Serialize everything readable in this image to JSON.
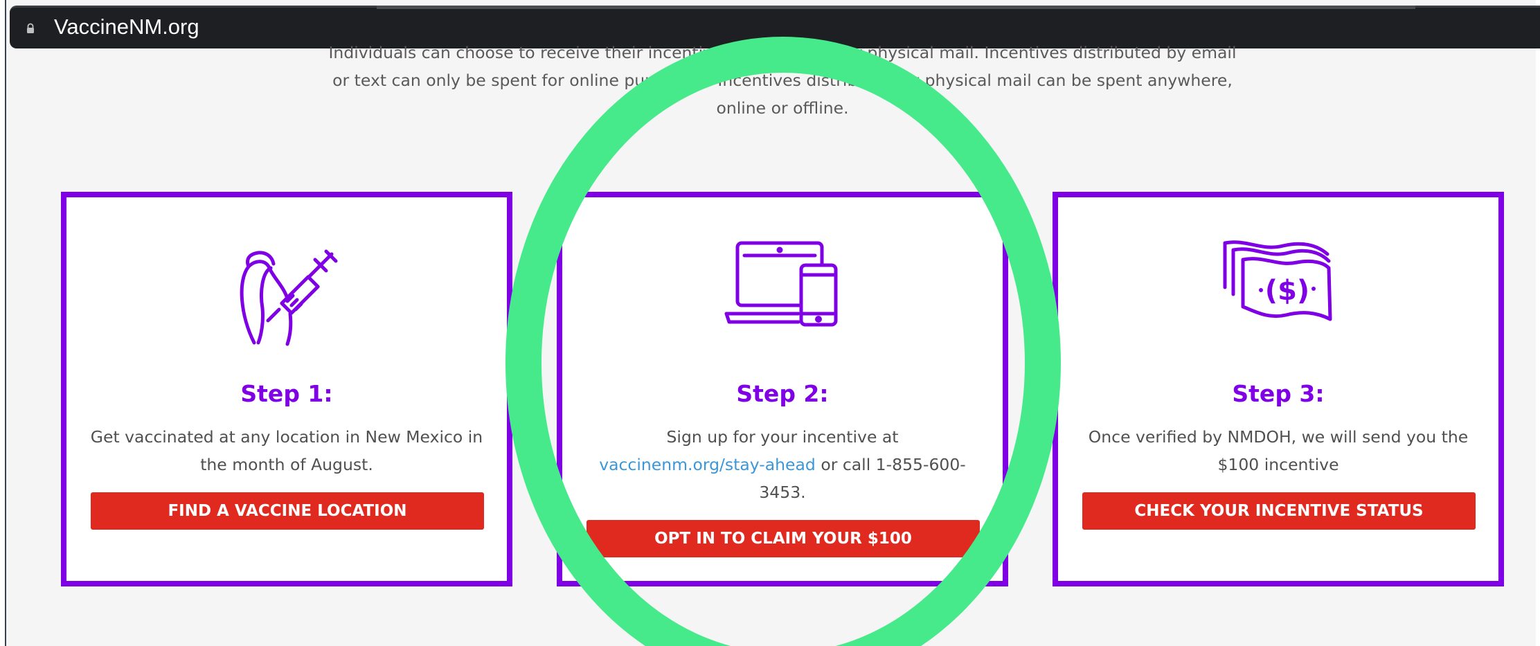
{
  "browser": {
    "url": "VaccineNM.org"
  },
  "intro": {
    "line1": "Individuals can choose to receive their incentive by email, text or physical mail. Incentives distributed by email",
    "line2": "or text can only be spent for online purchases. Incentives distributed by physical mail can be spent anywhere,",
    "line3": "online or offline."
  },
  "steps": [
    {
      "title": "Step 1:",
      "text": "Get vaccinated at any location in New Mexico in the month of August.",
      "button": "FIND A VACCINE LOCATION",
      "icon": "vaccine-arm-icon"
    },
    {
      "title": "Step 2:",
      "text_before": "Sign up for your incentive at",
      "link": "vaccinenm.org/stay-ahead",
      "text_after": "or call 1-855-600-3453.",
      "button": "OPT IN TO CLAIM YOUR $100",
      "icon": "devices-icon"
    },
    {
      "title": "Step 3:",
      "text": "Once verified by NMDOH, we will send you the $100 incentive",
      "button": "CHECK YOUR INCENTIVE STATUS",
      "icon": "money-icon"
    }
  ],
  "colors": {
    "accent_purple": "#8000e6",
    "button_red": "#e02a20",
    "link_blue": "#3b97d9",
    "highlight_green": "#46ea8a"
  }
}
